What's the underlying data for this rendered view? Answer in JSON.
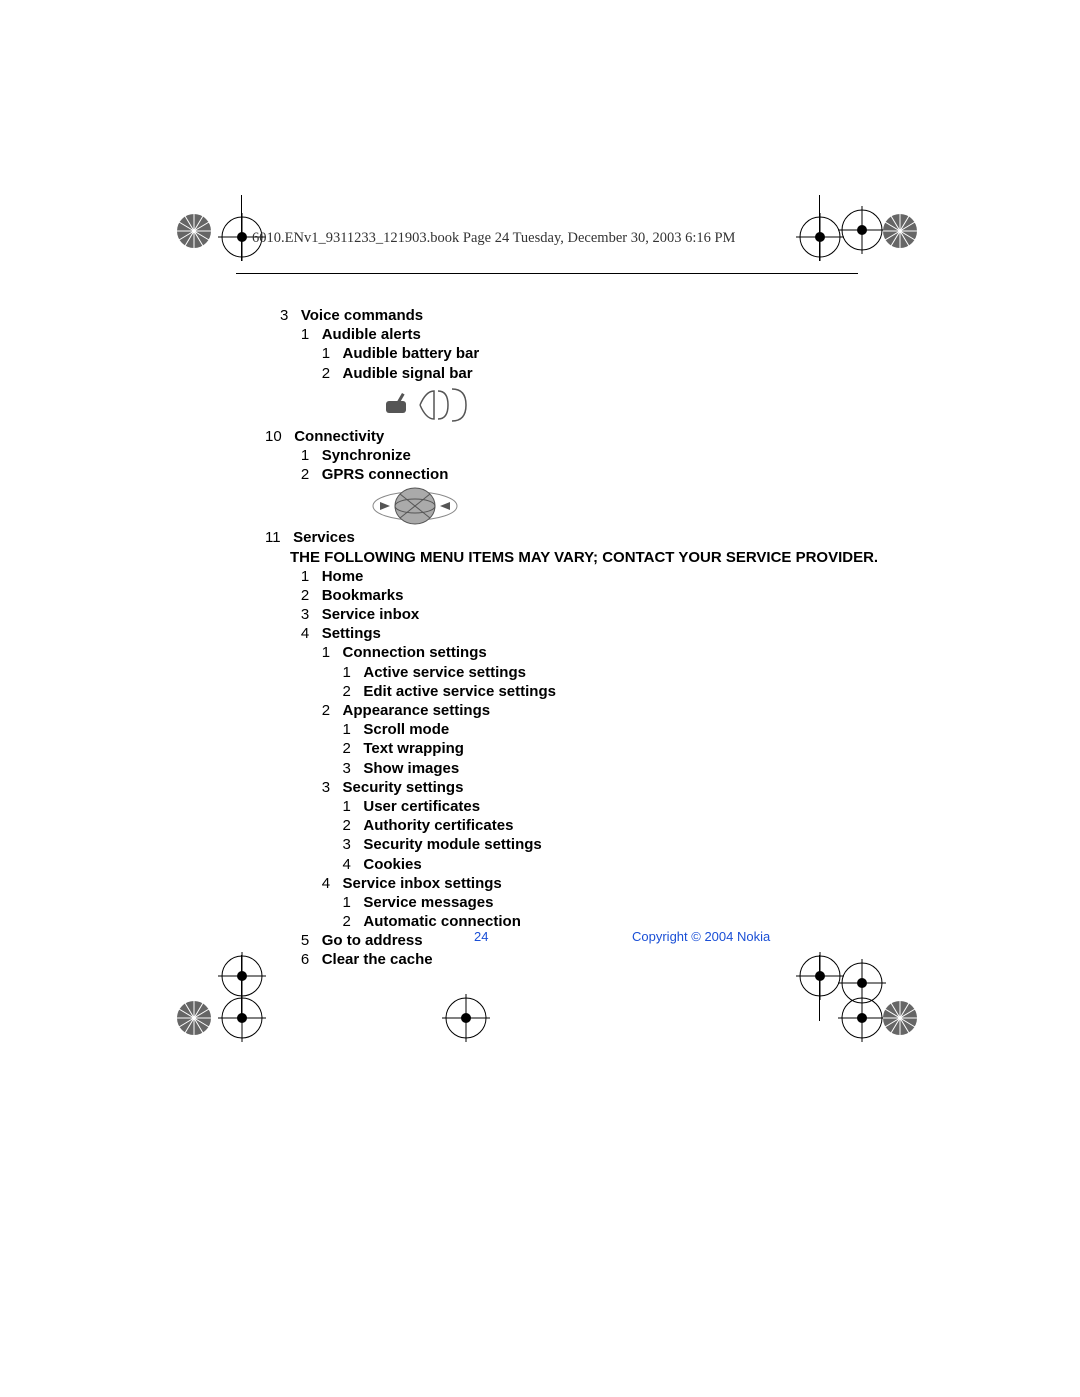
{
  "header": "6010.ENv1_9311233_121903.book  Page 24  Tuesday, December 30, 2003  6:16 PM",
  "menu": {
    "voice_commands_num": "3",
    "voice_commands": "Voice commands",
    "audible_alerts_num": "1",
    "audible_alerts": "Audible alerts",
    "audible_battery_num": "1",
    "audible_battery": "Audible battery bar",
    "audible_signal_num": "2",
    "audible_signal": "Audible signal bar",
    "connectivity_num": "10",
    "connectivity": "Connectivity",
    "synchronize_num": "1",
    "synchronize": "Synchronize",
    "gprs_num": "2",
    "gprs": "GPRS connection",
    "services_num": "11",
    "services": "Services",
    "services_note": "THE FOLLOWING MENU ITEMS MAY VARY; CONTACT YOUR SERVICE PROVIDER.",
    "home_num": "1",
    "home": "Home",
    "bookmarks_num": "2",
    "bookmarks": "Bookmarks",
    "service_inbox_num": "3",
    "service_inbox": "Service inbox",
    "settings_num": "4",
    "settings": "Settings",
    "conn_settings_num": "1",
    "conn_settings": "Connection settings",
    "active_service_num": "1",
    "active_service": "Active service settings",
    "edit_active_num": "2",
    "edit_active": "Edit active service settings",
    "appearance_num": "2",
    "appearance": "Appearance settings",
    "scroll_mode_num": "1",
    "scroll_mode": "Scroll mode",
    "text_wrap_num": "2",
    "text_wrap": "Text wrapping",
    "show_images_num": "3",
    "show_images": "Show images",
    "security_num": "3",
    "security": "Security settings",
    "user_cert_num": "1",
    "user_cert": "User certificates",
    "auth_cert_num": "2",
    "auth_cert": "Authority certificates",
    "sec_module_num": "3",
    "sec_module": "Security module settings",
    "cookies_num": "4",
    "cookies": "Cookies",
    "service_inbox_set_num": "4",
    "service_inbox_set": "Service inbox settings",
    "service_msg_num": "1",
    "service_msg": "Service messages",
    "auto_conn_num": "2",
    "auto_conn": "Automatic connection",
    "goto_num": "5",
    "goto": "Go to address",
    "clear_num": "6",
    "clear": "Clear the cache"
  },
  "footer": {
    "page": "24",
    "copyright": "Copyright © 2004 Nokia"
  }
}
